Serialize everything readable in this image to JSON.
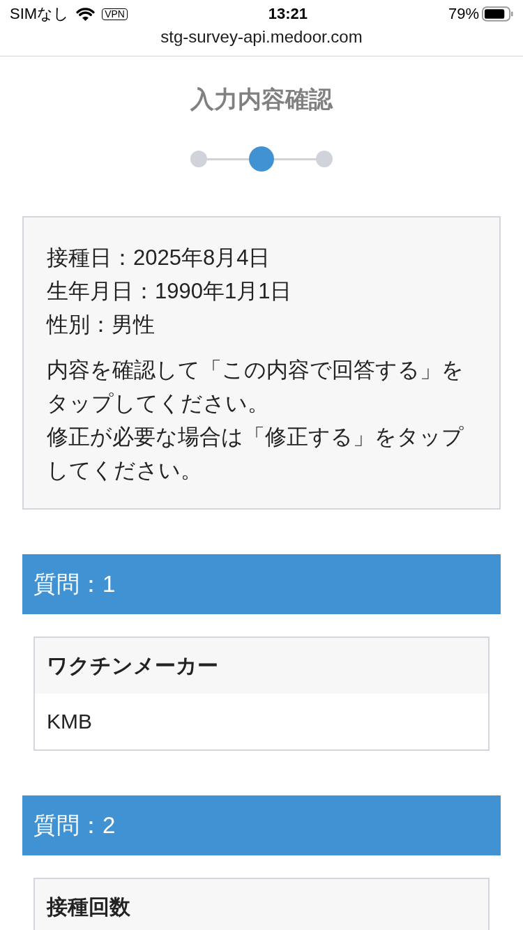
{
  "status_bar": {
    "carrier": "SIMなし",
    "vpn": "VPN",
    "time": "13:21",
    "battery": "79%"
  },
  "address_bar": {
    "url": "stg-survey-api.medoor.com"
  },
  "title": "入力内容確認",
  "stepper": {
    "steps": [
      {
        "selected": false
      },
      {
        "selected": true
      },
      {
        "selected": false
      }
    ]
  },
  "summary": {
    "entries": [
      "接種日：2025年8月4日",
      "生年月日：1990年1月1日",
      "性別：男性"
    ],
    "note": [
      "内容を確認して「この内容で回答する」をタップしてください。",
      "修正が必要な場合は「修正する」をタップしてください。"
    ]
  },
  "questions": [
    {
      "heading": "質問：1",
      "item": "ワクチンメーカー",
      "answer": "KMB"
    },
    {
      "heading": "質問：2",
      "item": "接種回数"
    }
  ]
}
